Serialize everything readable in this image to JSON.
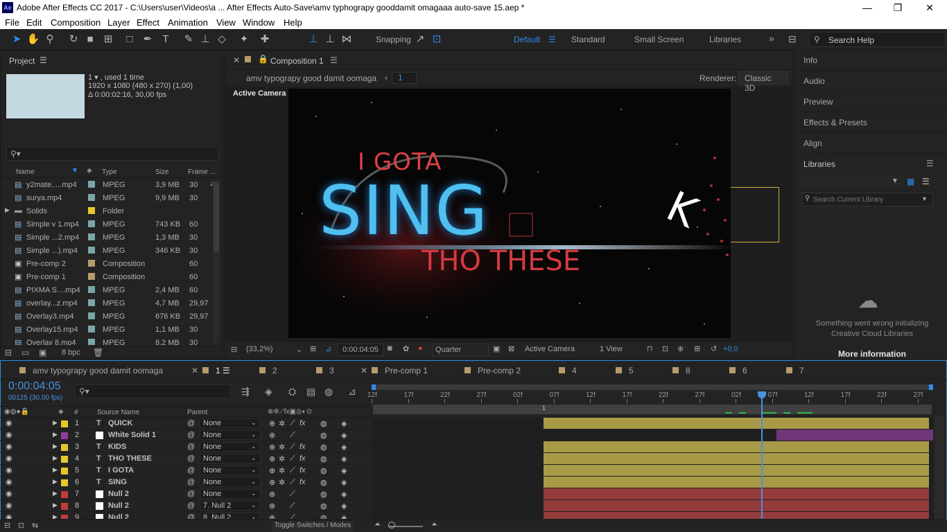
{
  "titlebar": {
    "logo": "Ae",
    "title": "Adobe After Effects CC 2017 - C:\\Users\\user\\Videos\\a ... After Effects Auto-Save\\amv typhograpy gooddamit omagaaa auto-save 15.aep *",
    "min": "—",
    "max": "❐",
    "close": "✕"
  },
  "menu": [
    "File",
    "Edit",
    "Composition",
    "Layer",
    "Effect",
    "Animation",
    "View",
    "Window",
    "Help"
  ],
  "toolbar": {
    "snapping": "Snapping",
    "workspaces": [
      "Default",
      "Standard",
      "Small Screen",
      "Libraries"
    ],
    "more": "»",
    "search": "Search Help"
  },
  "project": {
    "title": "Project",
    "info_line1": "1 ▾ , used 1 time",
    "info_line2": "1920 x 1080  (480 x 270) (1,00)",
    "info_line3": "Δ 0:00:02:16, 30,00 fps",
    "search_placeholder": "",
    "columns": [
      "Name",
      "Type",
      "Size",
      "Frame ..."
    ],
    "items": [
      {
        "name": "y2mate.....mp4",
        "type": "MPEG",
        "size": "3,9 MB",
        "fps": "30",
        "color": "#7aa6a8"
      },
      {
        "name": "surya.mp4",
        "type": "MPEG",
        "size": "9,9 MB",
        "fps": "30",
        "color": "#7aa6a8"
      },
      {
        "name": "Solids",
        "type": "Folder",
        "size": "",
        "fps": "",
        "color": "#e6c929"
      },
      {
        "name": "Simple v 1.mp4",
        "type": "MPEG",
        "size": "743 KB",
        "fps": "60",
        "color": "#7aa6a8"
      },
      {
        "name": "Simple ...2.mp4",
        "type": "MPEG",
        "size": "1,3 MB",
        "fps": "30",
        "color": "#7aa6a8"
      },
      {
        "name": "Simple ...).mp4",
        "type": "MPEG",
        "size": "346 KB",
        "fps": "30",
        "color": "#7aa6a8"
      },
      {
        "name": "Pre-comp 2",
        "type": "Composition",
        "size": "",
        "fps": "60",
        "color": "#b89b6c"
      },
      {
        "name": "Pre-comp 1",
        "type": "Composition",
        "size": "",
        "fps": "60",
        "color": "#b89b6c"
      },
      {
        "name": "PIXMA S....mp4",
        "type": "MPEG",
        "size": "2,4 MB",
        "fps": "60",
        "color": "#7aa6a8"
      },
      {
        "name": "overlay...z.mp4",
        "type": "MPEG",
        "size": "4,7 MB",
        "fps": "29,97",
        "color": "#7aa6a8"
      },
      {
        "name": "Overlay3.mp4",
        "type": "MPEG",
        "size": "676 KB",
        "fps": "29,97",
        "color": "#7aa6a8"
      },
      {
        "name": "Overlay15.mp4",
        "type": "MPEG",
        "size": "1,1 MB",
        "fps": "30",
        "color": "#7aa6a8"
      },
      {
        "name": "Overlay 8.mp4",
        "type": "MPEG",
        "size": "8,2 MB",
        "fps": "30",
        "color": "#7aa6a8"
      }
    ],
    "bpc": "8 bpc"
  },
  "comp": {
    "tab": "Composition 1",
    "breadcrumb": "amv typograpy good damit oomaga",
    "breadcrumb_sub": "1",
    "renderer_label": "Renderer:",
    "renderer": "Classic 3D",
    "camera_label": "Active Camera",
    "viewer_text": {
      "line1": "I GOTA",
      "line2": "SING",
      "line3": "THO THESE",
      "line4": "K"
    },
    "footer": {
      "zoom": "(33,2%)",
      "time": "0:00:04:05",
      "resolution": "Quarter",
      "camera": "Active Camera",
      "views": "1 View",
      "exposure": "+0,0"
    }
  },
  "right": {
    "panels": [
      "Info",
      "Audio",
      "Preview",
      "Effects & Presets",
      "Align"
    ],
    "libraries": "Libraries",
    "lib_search": "Search Current Library",
    "error": "Something went wrong initializing Creative Cloud Libraries",
    "more_info": "More information"
  },
  "timeline": {
    "tabs": [
      "amv typograpy good damit oomaga",
      "1",
      "2",
      "3",
      "Pre-comp 1",
      "Pre-comp 2",
      "4",
      "5",
      "8",
      "6",
      "7"
    ],
    "timecode": "0:00:04:05",
    "frames": "00125 (30.00 fps)",
    "col_source": "Source Name",
    "col_parent": "Parent",
    "col_hash": "#",
    "toggle": "Toggle Switches / Modes",
    "ruler": [
      "12f",
      "17f",
      "22f",
      "27f",
      "02f",
      "07f",
      "12f",
      "17f",
      "22f",
      "27f",
      "02f",
      "07f",
      "12f",
      "17f",
      "22f",
      "27f"
    ],
    "marker": "1",
    "layers": [
      {
        "num": "1",
        "type": "T",
        "name": "QUICK",
        "parent": "None",
        "color": "#e6c929"
      },
      {
        "num": "2",
        "type": "□",
        "name": "White Solid 1",
        "parent": "None",
        "color": "#8e3ca0"
      },
      {
        "num": "3",
        "type": "T",
        "name": "KIDS",
        "parent": "None",
        "color": "#e6c929"
      },
      {
        "num": "4",
        "type": "T",
        "name": "THO THESE",
        "parent": "None",
        "color": "#e6c929"
      },
      {
        "num": "5",
        "type": "T",
        "name": "I GOTA",
        "parent": "None",
        "color": "#e6c929"
      },
      {
        "num": "6",
        "type": "T",
        "name": "SING",
        "parent": "None",
        "color": "#e6c929"
      },
      {
        "num": "7",
        "type": "□",
        "name": "Null 2",
        "parent": "None",
        "color": "#c23a3a"
      },
      {
        "num": "8",
        "type": "□",
        "name": "Null 2",
        "parent": "7. Null 2",
        "color": "#c23a3a"
      },
      {
        "num": "9",
        "type": "□",
        "name": "Null 2",
        "parent": "8. Null 2",
        "color": "#c23a3a"
      }
    ]
  },
  "colors": {
    "accent": "#2d8ceb",
    "time": "#4a90e2",
    "bar_yellow": "#a99a47",
    "bar_red": "#953b3b",
    "bar_purple": "#6e3679"
  }
}
